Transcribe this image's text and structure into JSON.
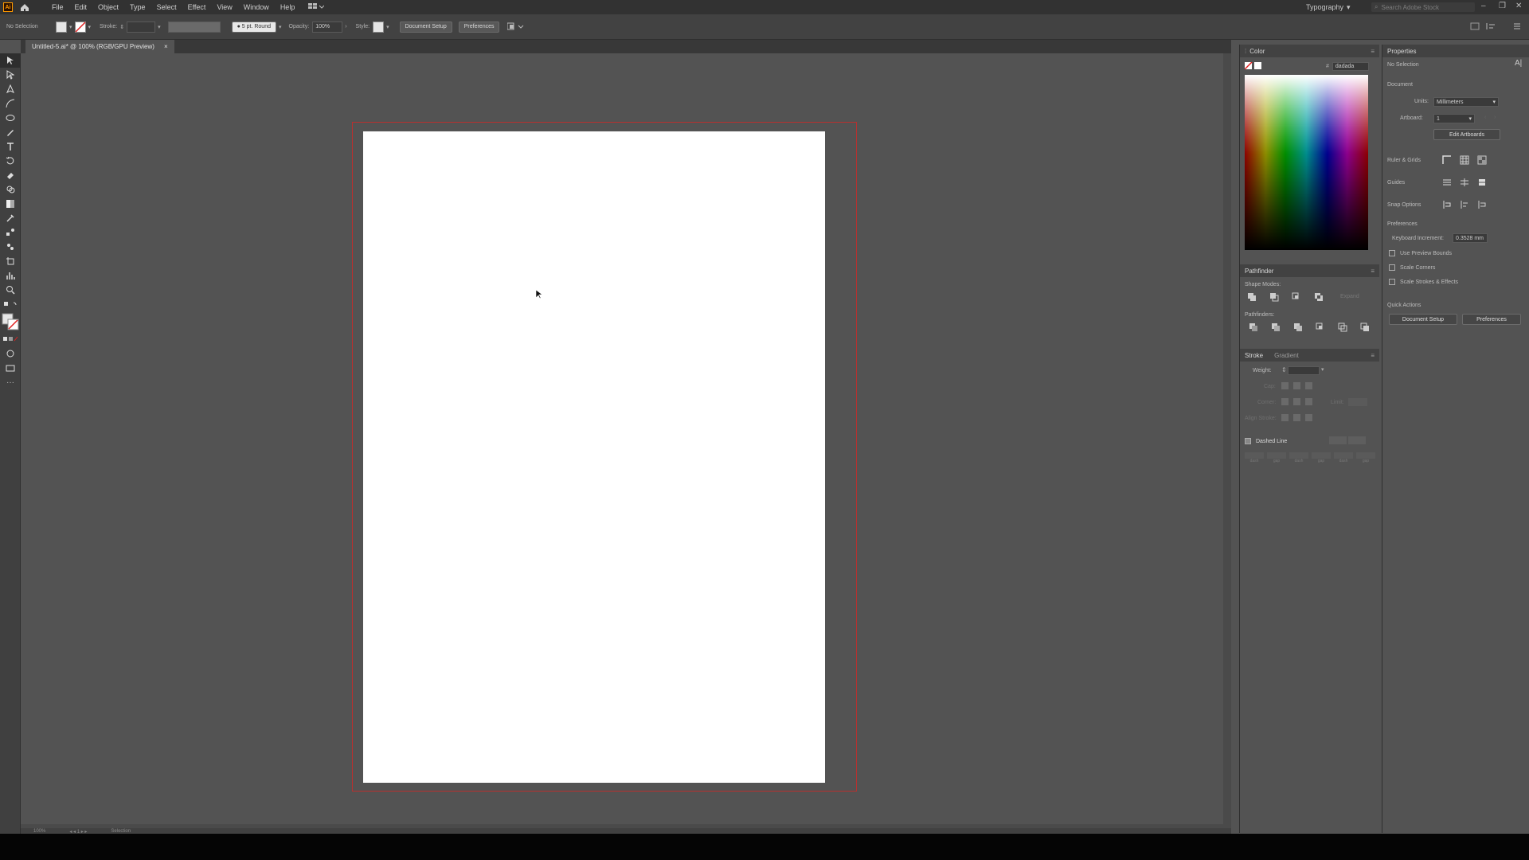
{
  "menubar": {
    "app_logo": "Ai",
    "items": [
      "File",
      "Edit",
      "Object",
      "Type",
      "Select",
      "Effect",
      "View",
      "Window",
      "Help"
    ],
    "workspace": "Typography",
    "search_placeholder": "Search Adobe Stock"
  },
  "controlbar": {
    "selection": "No Selection",
    "stroke_label": "Stroke:",
    "brush": "5 pt. Round",
    "opacity_label": "Opacity:",
    "opacity_value": "100%",
    "style_label": "Style:",
    "document_setup": "Document Setup",
    "preferences": "Preferences"
  },
  "document_tab": {
    "title": "Untitled-5.ai* @ 100% (RGB/GPU Preview)",
    "close": "×"
  },
  "color_panel": {
    "title": "Color",
    "hex_value": "dadada"
  },
  "pathfinder_panel": {
    "title": "Pathfinder",
    "shape_modes_label": "Shape Modes:",
    "expand_label": "Expand",
    "pathfinders_label": "Pathfinders:"
  },
  "stroke_panel": {
    "tab_stroke": "Stroke",
    "tab_gradient": "Gradient",
    "weight_label": "Weight:",
    "cap_label": "Cap:",
    "corner_label": "Corner:",
    "limit_label": "Limit:",
    "align_label": "Align Stroke:",
    "dashed_label": "Dashed Line",
    "dash_fields": [
      "dash",
      "gap",
      "dash",
      "gap",
      "dash",
      "gap"
    ]
  },
  "properties_panel": {
    "title": "Properties",
    "selection": "No Selection",
    "document_label": "Document",
    "units_label": "Units:",
    "units_value": "Millimeters",
    "artboard_label": "Artboard:",
    "artboard_value": "1",
    "edit_artboards": "Edit Artboards",
    "ruler_grids": "Ruler & Grids",
    "guides": "Guides",
    "snap_options": "Snap Options",
    "preferences_label": "Preferences",
    "keyboard_increment_label": "Keyboard Increment:",
    "keyboard_increment_value": "0.3528 mm",
    "use_preview_bounds": "Use Preview Bounds",
    "scale_corners": "Scale Corners",
    "scale_strokes": "Scale Strokes & Effects",
    "quick_actions": "Quick Actions",
    "document_setup": "Document Setup",
    "preferences": "Preferences"
  },
  "statusbar": {
    "zoom": "100%",
    "tool": "Selection"
  },
  "colors": {
    "bleed": "#b8302f",
    "accent": "#ff9a00",
    "artboard": "#ffffff"
  }
}
